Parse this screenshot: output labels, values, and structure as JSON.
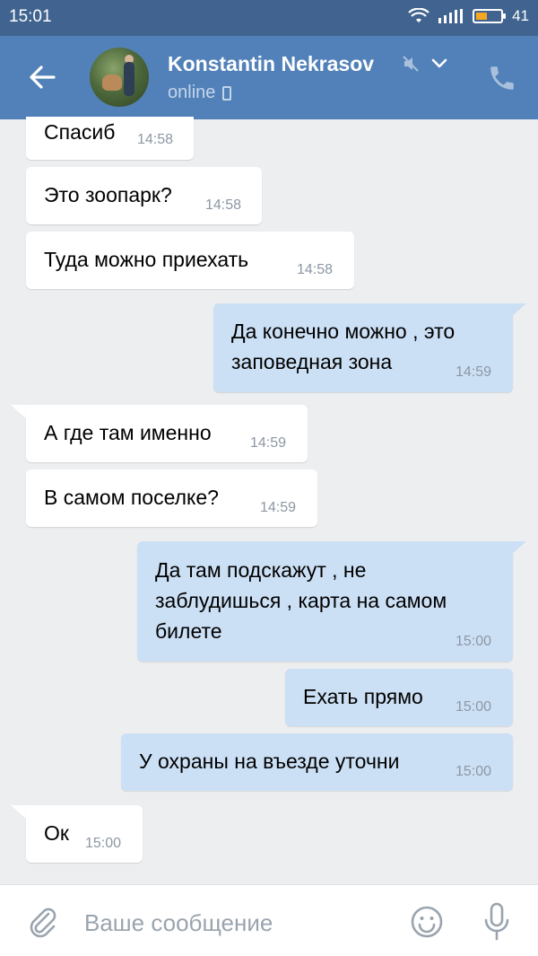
{
  "status_bar": {
    "time": "15:01",
    "battery_level": "41",
    "icons": [
      "wifi-icon",
      "signal-icon",
      "battery-icon"
    ]
  },
  "header": {
    "contact_name": "Konstantin Nekrasov",
    "status": "online",
    "icons": [
      "back-arrow-icon",
      "mute-icon",
      "chevron-down-icon",
      "mobile-device-icon",
      "phone-call-icon"
    ]
  },
  "messages": [
    {
      "direction": "in",
      "text": "Спасиб",
      "time": "14:58"
    },
    {
      "direction": "in",
      "text": "Это зоопарк?",
      "time": "14:58"
    },
    {
      "direction": "in",
      "text": "Туда можно приехать",
      "time": "14:58"
    },
    {
      "direction": "out",
      "lines": [
        "Да конечно можно , это",
        "заповедная зона"
      ],
      "time": "14:59"
    },
    {
      "direction": "in",
      "text": "А где там именно",
      "time": "14:59"
    },
    {
      "direction": "in",
      "text": "В самом поселке?",
      "time": "14:59"
    },
    {
      "direction": "out",
      "lines": [
        "Да там подскажут , не",
        "заблудишься , карта на самом",
        "билете"
      ],
      "time": "15:00"
    },
    {
      "direction": "out",
      "text": "Ехать прямо",
      "time": "15:00"
    },
    {
      "direction": "out",
      "text": "У охраны на въезде уточни",
      "time": "15:00"
    },
    {
      "direction": "in",
      "text": "Ок",
      "time": "15:00"
    }
  ],
  "composer": {
    "placeholder": "Ваше сообщение",
    "icons": [
      "attach-icon",
      "emoji-icon",
      "microphone-icon"
    ]
  },
  "colors": {
    "header": "#5181b8",
    "status_bar": "#40648f",
    "background": "#edeef0",
    "outgoing_bubble": "#cce0f5",
    "incoming_bubble": "#ffffff"
  }
}
